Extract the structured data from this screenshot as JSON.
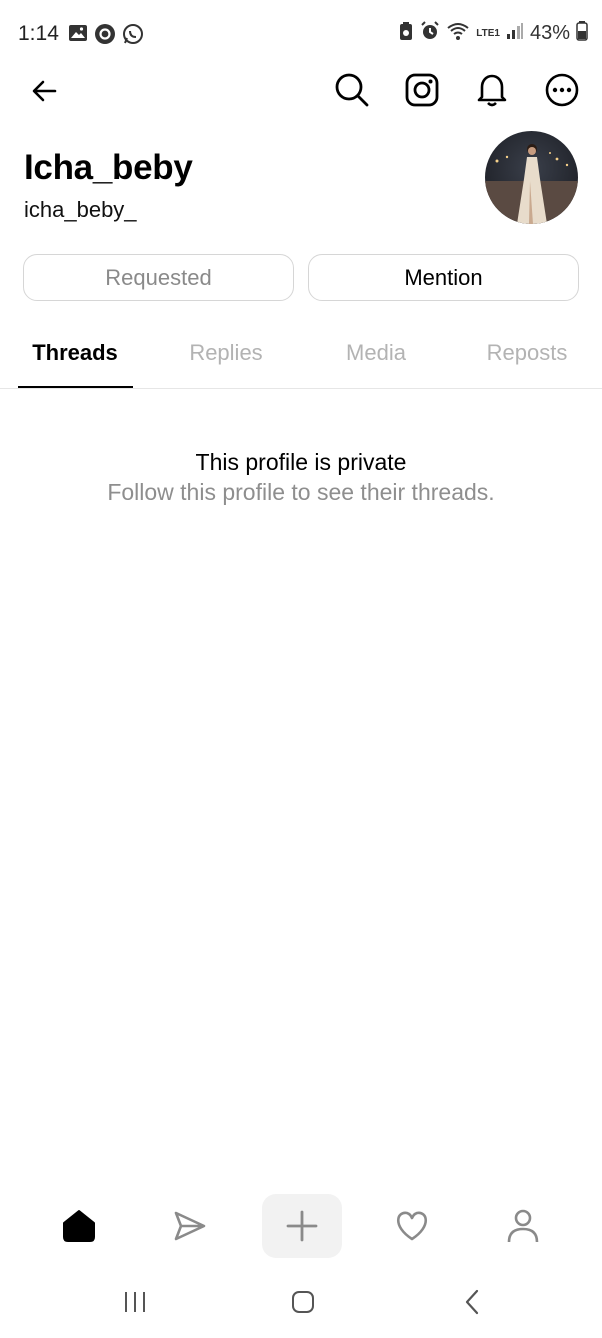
{
  "status_bar": {
    "time": "1:14",
    "battery": "43%",
    "network": "LTE1"
  },
  "profile": {
    "name": "Icha_beby",
    "handle": "icha_beby_"
  },
  "buttons": {
    "requested": "Requested",
    "mention": "Mention"
  },
  "tabs": [
    {
      "label": "Threads",
      "active": true
    },
    {
      "label": "Replies",
      "active": false
    },
    {
      "label": "Media",
      "active": false
    },
    {
      "label": "Reposts",
      "active": false
    }
  ],
  "empty_state": {
    "title": "This profile is private",
    "subtitle": "Follow this profile to see their threads."
  },
  "icons": {
    "header": [
      "back-arrow-icon",
      "search-icon",
      "instagram-icon",
      "bell-icon",
      "more-icon"
    ],
    "bottom_nav": [
      "home-icon",
      "send-icon",
      "plus-icon",
      "heart-icon",
      "profile-icon"
    ]
  },
  "colors": {
    "inactive_text": "#b3b3b3",
    "border": "#d6d6d6",
    "subtitle": "#8e8e8e"
  }
}
